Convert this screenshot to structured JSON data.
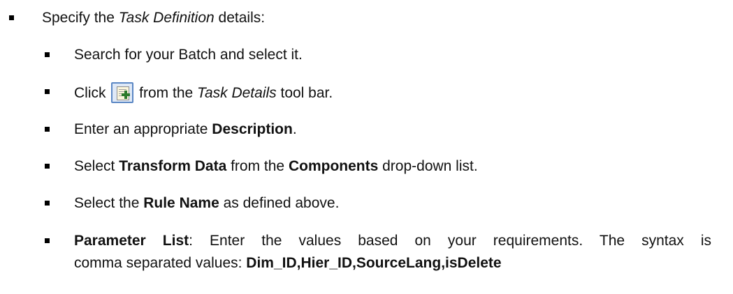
{
  "main_item": {
    "prefix": "Specify the ",
    "italic": "Task Definition",
    "suffix": " details:"
  },
  "steps": [
    {
      "text": "Search for your Batch and select it."
    },
    {
      "prefix": "Click ",
      "icon": "add-task-icon",
      "middle": " from the ",
      "italic": "Task Details",
      "suffix": " tool bar."
    },
    {
      "prefix": "Enter an appropriate ",
      "bold": "Description",
      "suffix": "."
    },
    {
      "prefix": "Select ",
      "bold1": "Transform Data",
      "middle": " from the ",
      "bold2": "Components",
      "suffix": " drop-down list."
    },
    {
      "prefix": "Select the ",
      "bold": "Rule Name",
      "suffix": " as defined above."
    },
    {
      "bold": "Parameter List",
      "line1_suffix": ": Enter the values based on your requirements. The syntax is",
      "line2_prefix": "comma separated values: ",
      "syntax": "Dim_ID,Hier_ID,SourceLang,isDelete"
    }
  ]
}
